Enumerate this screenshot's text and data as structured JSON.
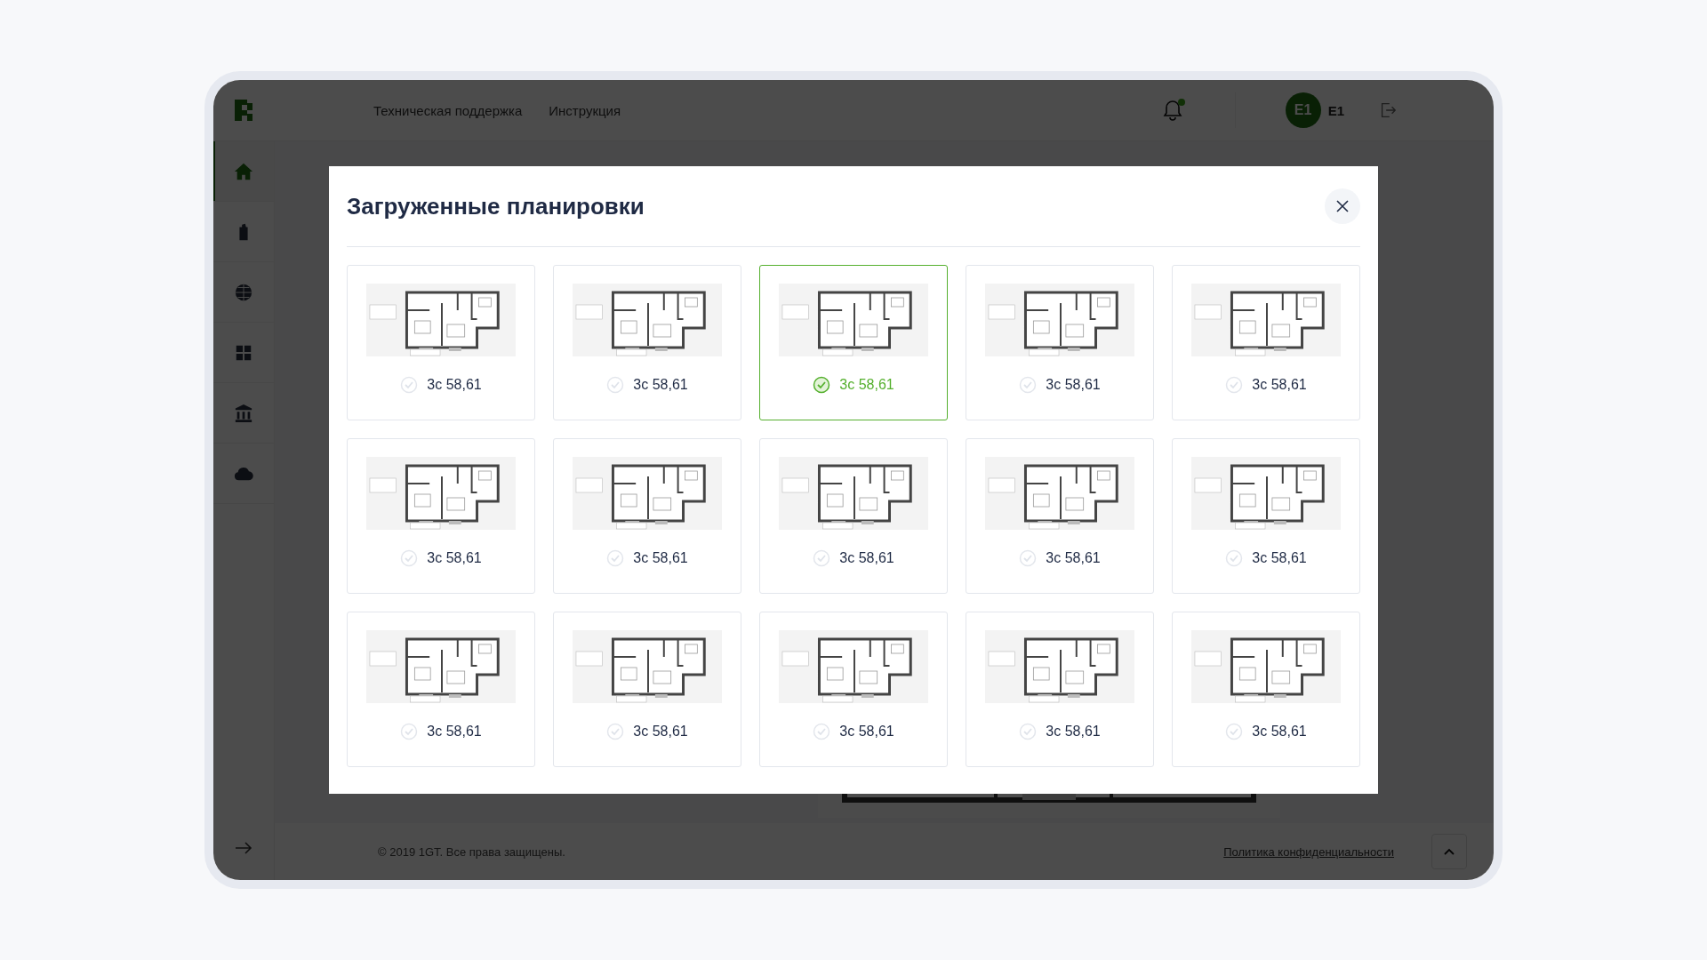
{
  "topbar": {
    "links": [
      "Техническая поддержка",
      "Инструкция"
    ],
    "notification": {
      "unread": true
    },
    "user": {
      "initials": "E1",
      "name": "E1"
    }
  },
  "sidebar": {
    "items": [
      {
        "selected": true
      },
      {
        "selected": false
      },
      {
        "selected": false
      },
      {
        "selected": false
      },
      {
        "selected": false
      },
      {
        "selected": false
      }
    ]
  },
  "footer": {
    "copyright": "© 2019 1GT. Все права защищены.",
    "privacy_link": "Политика конфиденциальности"
  },
  "modal": {
    "title": "Загруженные планировки",
    "plans": [
      {
        "label": "3с 58,61",
        "selected": false,
        "kind": "picture"
      },
      {
        "label": "3с 58,61",
        "selected": false,
        "kind": "picture"
      },
      {
        "label": "3с 58,61",
        "selected": true,
        "kind": "picture"
      },
      {
        "label": "3с 58,61",
        "selected": false,
        "kind": "picture"
      },
      {
        "label": "3с 58,61",
        "selected": false,
        "kind": "picture"
      },
      {
        "label": "3с 58,61",
        "selected": false,
        "kind": "picture"
      },
      {
        "label": "3с 58,61",
        "selected": false,
        "kind": "picture"
      },
      {
        "label": "3с 58,61",
        "selected": false,
        "kind": "picture"
      },
      {
        "label": "3с 58,61",
        "selected": false,
        "kind": "picture"
      },
      {
        "label": "3с 58,61",
        "selected": false,
        "kind": "picture"
      },
      {
        "label": "3с 58,61",
        "selected": false,
        "kind": "picture"
      },
      {
        "label": "3с 58,61",
        "selected": false,
        "kind": "picture"
      },
      {
        "label": "3с 58,61",
        "selected": false,
        "kind": "picture"
      },
      {
        "label": "3с 58,61",
        "selected": false,
        "kind": "picture"
      },
      {
        "label": "3с 58,61",
        "selected": false,
        "kind": "picture"
      }
    ]
  }
}
